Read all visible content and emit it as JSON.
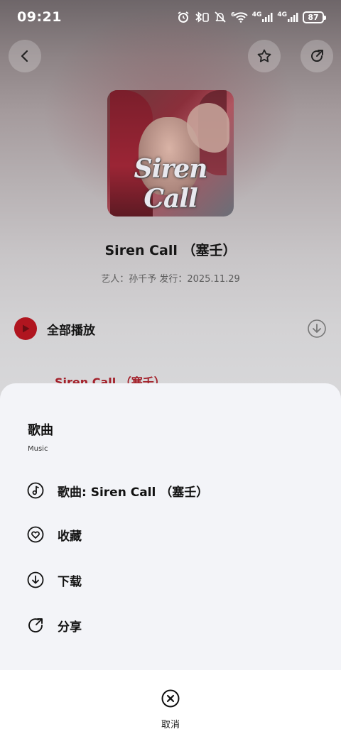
{
  "status_bar": {
    "time": "09:21",
    "network_1": "4G",
    "network_2": "4G",
    "wifi_badge": "6",
    "battery": "87"
  },
  "nav": {
    "back_icon": "chevron-left-icon",
    "favorite_icon": "star-icon",
    "share_icon": "share-icon"
  },
  "album": {
    "cover_text": "Siren Call",
    "title": "Siren Call （塞壬）",
    "meta": "艺人：孙千予 发行：2025.11.29"
  },
  "play_all": {
    "label": "全部播放"
  },
  "song_peek": "Siren Call （塞壬）",
  "sheet": {
    "title": "歌曲",
    "subtitle": "Music",
    "items": [
      {
        "label": "歌曲: Siren Call （塞壬）",
        "icon": "music-note-icon"
      },
      {
        "label": "收藏",
        "icon": "heart-icon"
      },
      {
        "label": "下载",
        "icon": "download-icon"
      },
      {
        "label": "分享",
        "icon": "share-icon"
      }
    ]
  },
  "footer": {
    "cancel_label": "取消"
  },
  "colors": {
    "accent": "#b0151f",
    "sheet_bg": "#f3f4f8",
    "footer_bg": "#ffffff"
  }
}
